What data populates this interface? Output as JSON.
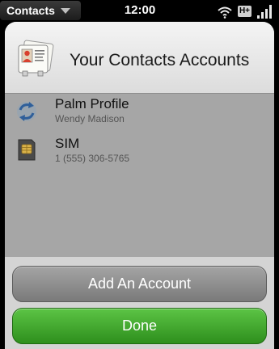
{
  "status_bar": {
    "app_name": "Contacts",
    "time": "12:00",
    "network": "H+",
    "icons": [
      "chevron-down-icon",
      "wifi-icon",
      "network-type-icon",
      "signal-strength-icon"
    ]
  },
  "header": {
    "title": "Your Contacts Accounts",
    "icon": "contacts-cards-icon"
  },
  "accounts": [
    {
      "name": "Palm Profile",
      "detail": "Wendy Madison",
      "icon": "sync-arrows-icon"
    },
    {
      "name": "SIM",
      "detail": "1 (555) 306-5765",
      "icon": "sim-card-icon"
    }
  ],
  "buttons": {
    "add_account": "Add An Account",
    "done": "Done"
  },
  "colors": {
    "done_button": "#3fa62c",
    "add_button": "#8e8e8e",
    "list_background": "#a6a6a6",
    "header_background": "#ececec"
  }
}
